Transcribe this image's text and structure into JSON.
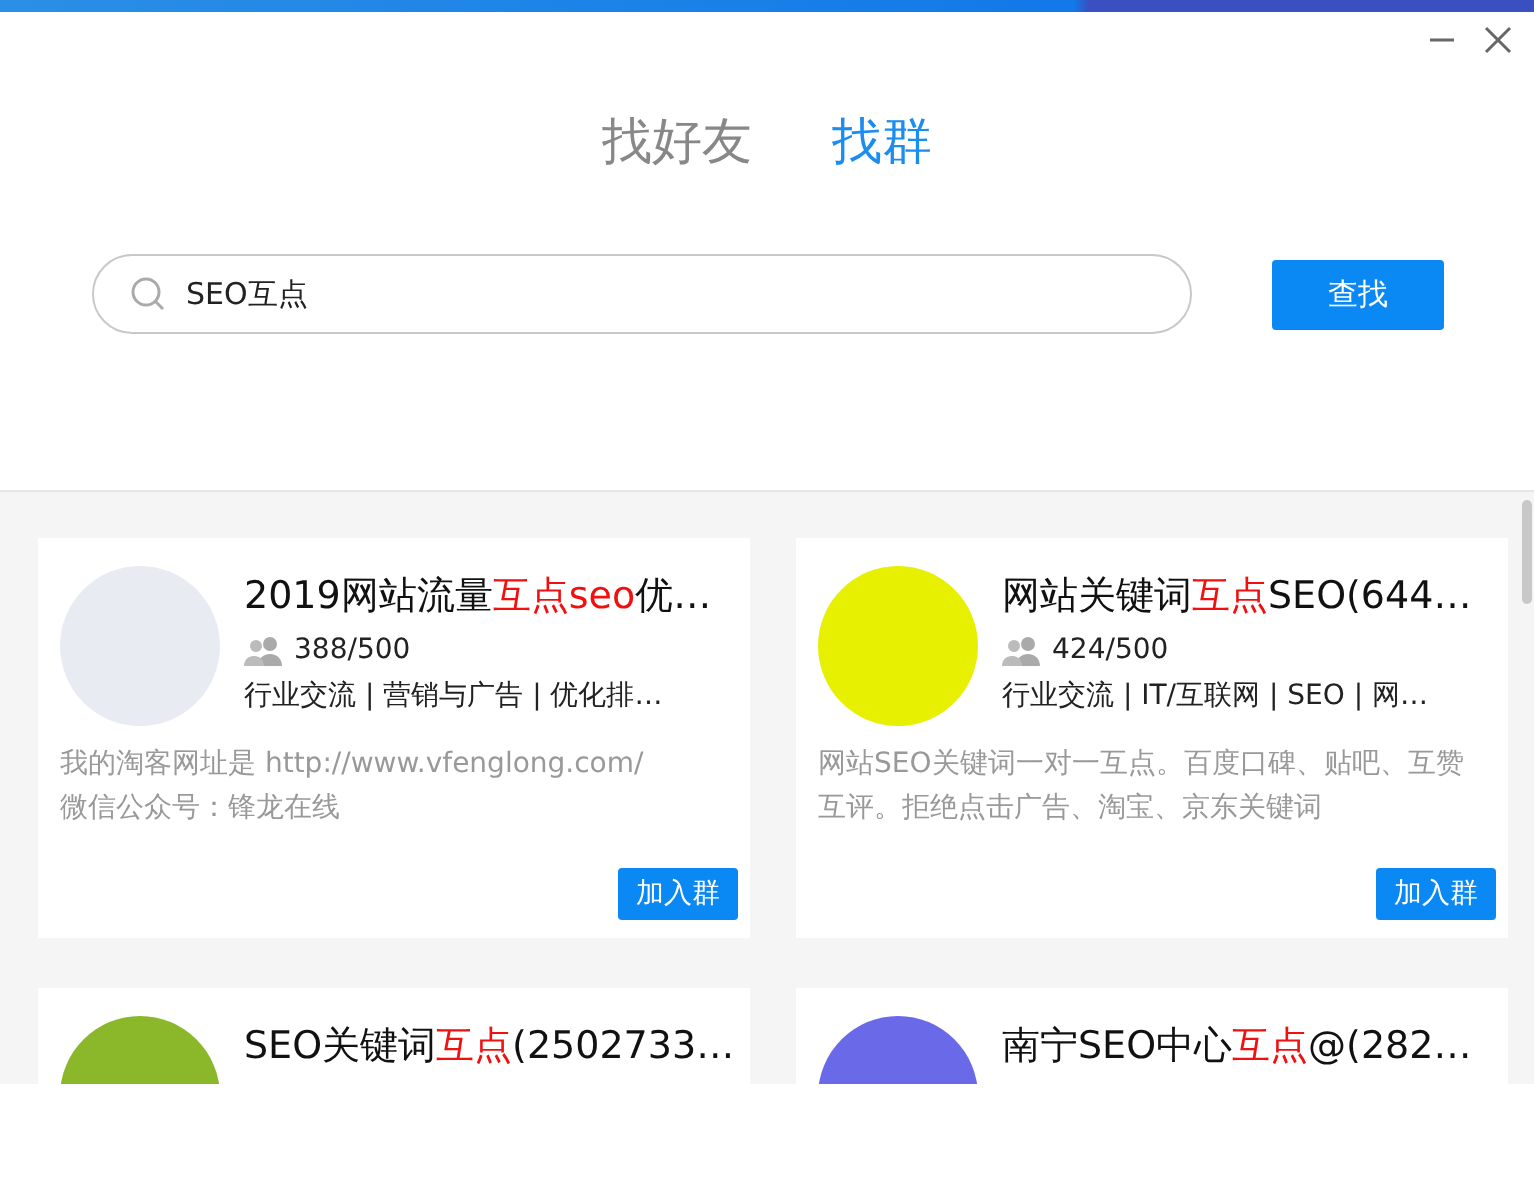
{
  "tabs": [
    {
      "label": "找好友",
      "selected": false
    },
    {
      "label": "找群",
      "selected": true
    }
  ],
  "search": {
    "value": "SEO互点",
    "button": "查找"
  },
  "groups": [
    {
      "color": "#e8ecf2",
      "title": [
        {
          "text": "2019网站流量",
          "highlight": false
        },
        {
          "text": "互点seo",
          "highlight": true
        },
        {
          "text": "优…",
          "highlight": false
        }
      ],
      "members": "388/500",
      "tags": "行业交流 | 营销与广告 | 优化排…",
      "description": "我的淘客网址是 http://www.vfenglong.com/\n微信公众号：锋龙在线",
      "button": "加入群"
    },
    {
      "color": "#e6f000",
      "title": [
        {
          "text": "网站关键词",
          "highlight": false
        },
        {
          "text": "互点",
          "highlight": true
        },
        {
          "text": "SEO(644…",
          "highlight": false
        }
      ],
      "members": "424/500",
      "tags": "行业交流 | IT/互联网 | SEO | 网…",
      "description": "网站SEO关键词一对一互点。百度口碑、贴吧、互赞互评。拒绝点击广告、淘宝、京东关键词",
      "button": "加入群"
    },
    {
      "color": "#8ab82a",
      "title": [
        {
          "text": "SEO关键词",
          "highlight": false
        },
        {
          "text": "互点",
          "highlight": true
        },
        {
          "text": "(2502733…",
          "highlight": false
        }
      ]
    },
    {
      "color": "#6a6ae8",
      "title": [
        {
          "text": "南宁SEO中心",
          "highlight": false
        },
        {
          "text": "互点",
          "highlight": true
        },
        {
          "text": "@(282…",
          "highlight": false
        }
      ]
    }
  ]
}
